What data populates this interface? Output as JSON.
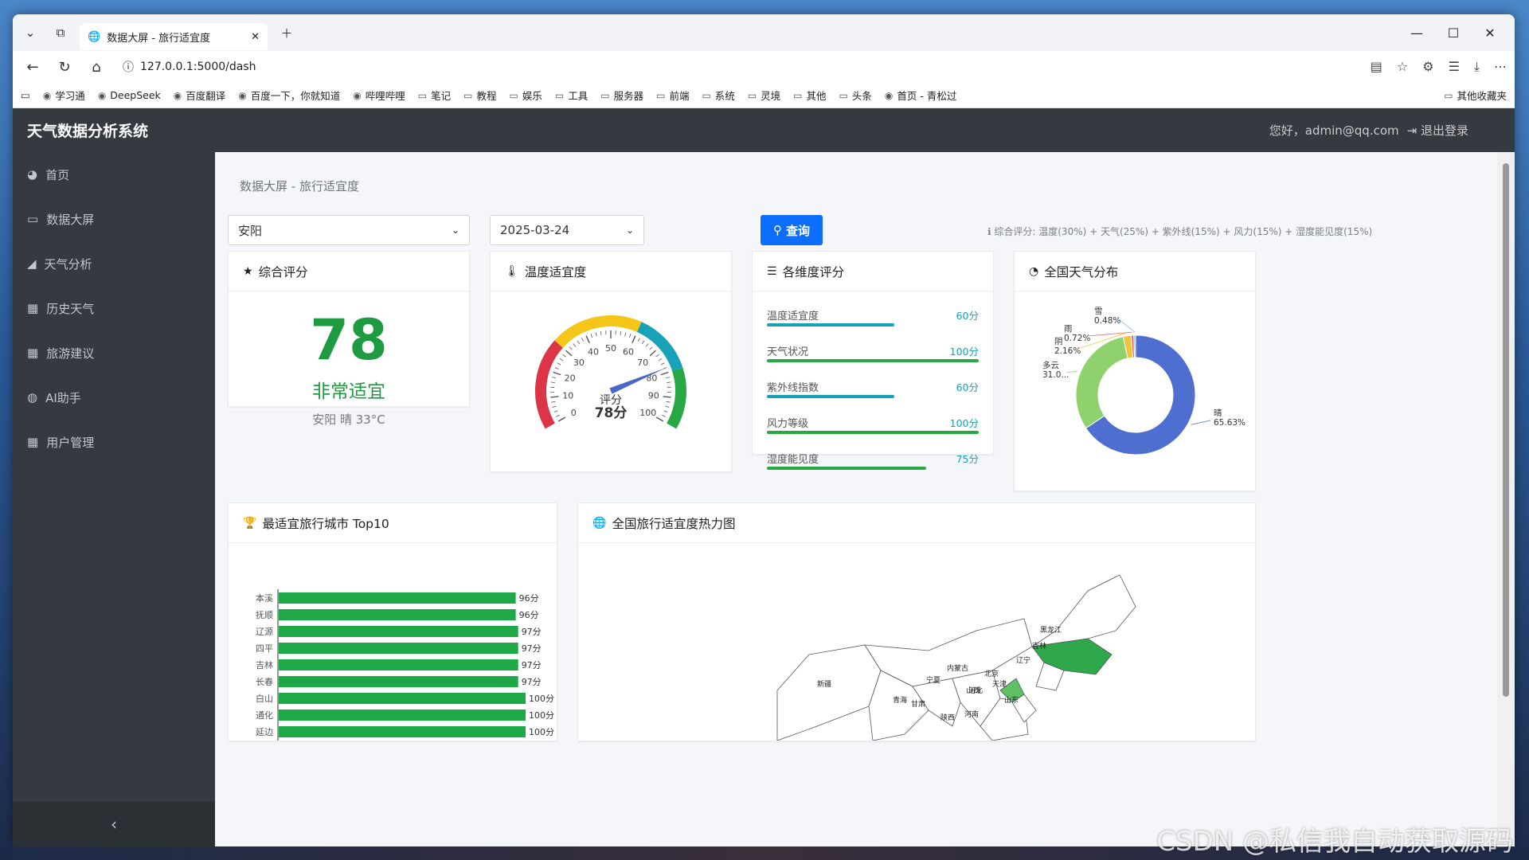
{
  "browser": {
    "tab_title": "数据大屏 - 旅行适宜度",
    "url": "127.0.0.1:5000/dash",
    "bookmarks": [
      "学习通",
      "DeepSeek",
      "百度翻译",
      "百度一下，你就知道",
      "哔哩哔哩",
      "笔记",
      "教程",
      "娱乐",
      "工具",
      "服务器",
      "前端",
      "系统",
      "灵境",
      "其他",
      "头条",
      "首页 - 青松过"
    ],
    "bookmarks_right": "其他收藏夹"
  },
  "app": {
    "brand": "天气数据分析系统",
    "greeting": "您好，admin@qq.com",
    "logout": "退出登录"
  },
  "sidebar": {
    "items": [
      {
        "label": "首页",
        "icon": "dashboard-icon"
      },
      {
        "label": "数据大屏",
        "icon": "monitor-icon"
      },
      {
        "label": "天气分析",
        "icon": "area-chart-icon"
      },
      {
        "label": "历史天气",
        "icon": "table-icon"
      },
      {
        "label": "旅游建议",
        "icon": "table-icon"
      },
      {
        "label": "AI助手",
        "icon": "chat-icon"
      },
      {
        "label": "用户管理",
        "icon": "table-icon"
      }
    ],
    "collapse": "‹"
  },
  "page": {
    "breadcrumb": "数据大屏 - 旅行适宜度",
    "city_select": "安阳",
    "date_select": "2025-03-24",
    "query_button": "查询",
    "formula": "综合评分: 温度(30%) + 天气(25%) + 紫外线(15%) + 风力(15%) + 湿度能见度(15%)"
  },
  "score_card": {
    "title": "综合评分",
    "score": "78",
    "level": "非常适宜",
    "detail": "安阳 晴 33°C"
  },
  "gauge_card": {
    "title": "温度适宜度",
    "value": 78,
    "ticks": [
      "0",
      "10",
      "20",
      "30",
      "40",
      "50",
      "60",
      "70",
      "80",
      "90",
      "100"
    ],
    "center_label": "评分",
    "center_value": "78分",
    "colors": [
      "#dc3545",
      "#f5c518",
      "#17a2b8",
      "#28a745"
    ]
  },
  "dimension_card": {
    "title": "各维度评分",
    "rows": [
      {
        "label": "温度适宜度",
        "value": "60分",
        "pct": 60,
        "color": "#17a2b8"
      },
      {
        "label": "天气状况",
        "value": "100分",
        "pct": 100,
        "color": "#28a745"
      },
      {
        "label": "紫外线指数",
        "value": "60分",
        "pct": 60,
        "color": "#17a2b8"
      },
      {
        "label": "风力等级",
        "value": "100分",
        "pct": 100,
        "color": "#28a745"
      },
      {
        "label": "湿度能见度",
        "value": "75分",
        "pct": 75,
        "color": "#28a745"
      }
    ]
  },
  "weather_card": {
    "title": "全国天气分布"
  },
  "top10_card": {
    "title": "最适宜旅行城市 Top10"
  },
  "heatmap_card": {
    "title": "全国旅行适宜度热力图",
    "labels": [
      "新疆",
      "黑龙江",
      "吉林",
      "辽宁",
      "内蒙古",
      "北京",
      "天津",
      "河北",
      "山西",
      "山东",
      "宁夏",
      "青海",
      "甘肃",
      "陕西",
      "河南"
    ]
  },
  "chart_data": [
    {
      "type": "pie",
      "title": "全国天气分布",
      "labels": [
        "晴",
        "多云",
        "阴",
        "雨",
        "雪"
      ],
      "values": [
        65.63,
        31.0,
        2.16,
        0.72,
        0.48
      ],
      "label_text": [
        "晴\n65.63%",
        "多云\n31.0...",
        "阴\n2.16%",
        "雨\n0.72%",
        "雪\n0.48%"
      ],
      "colors": [
        "#4e6fd0",
        "#8ed16d",
        "#f1c33c",
        "#ee6c66",
        "#6ec3dc"
      ]
    },
    {
      "type": "bar",
      "title": "最适宜旅行城市 Top10",
      "categories": [
        "本溪",
        "抚顺",
        "辽源",
        "四平",
        "吉林",
        "长春",
        "白山",
        "通化",
        "延边"
      ],
      "values": [
        96,
        96,
        97,
        97,
        97,
        97,
        100,
        100,
        100
      ],
      "value_labels": [
        "96分",
        "96分",
        "97分",
        "97分",
        "97分",
        "97分",
        "100分",
        "100分",
        "100分"
      ],
      "color": "#1fa847"
    }
  ],
  "watermark": "CSDN @私信我自动获取源码"
}
